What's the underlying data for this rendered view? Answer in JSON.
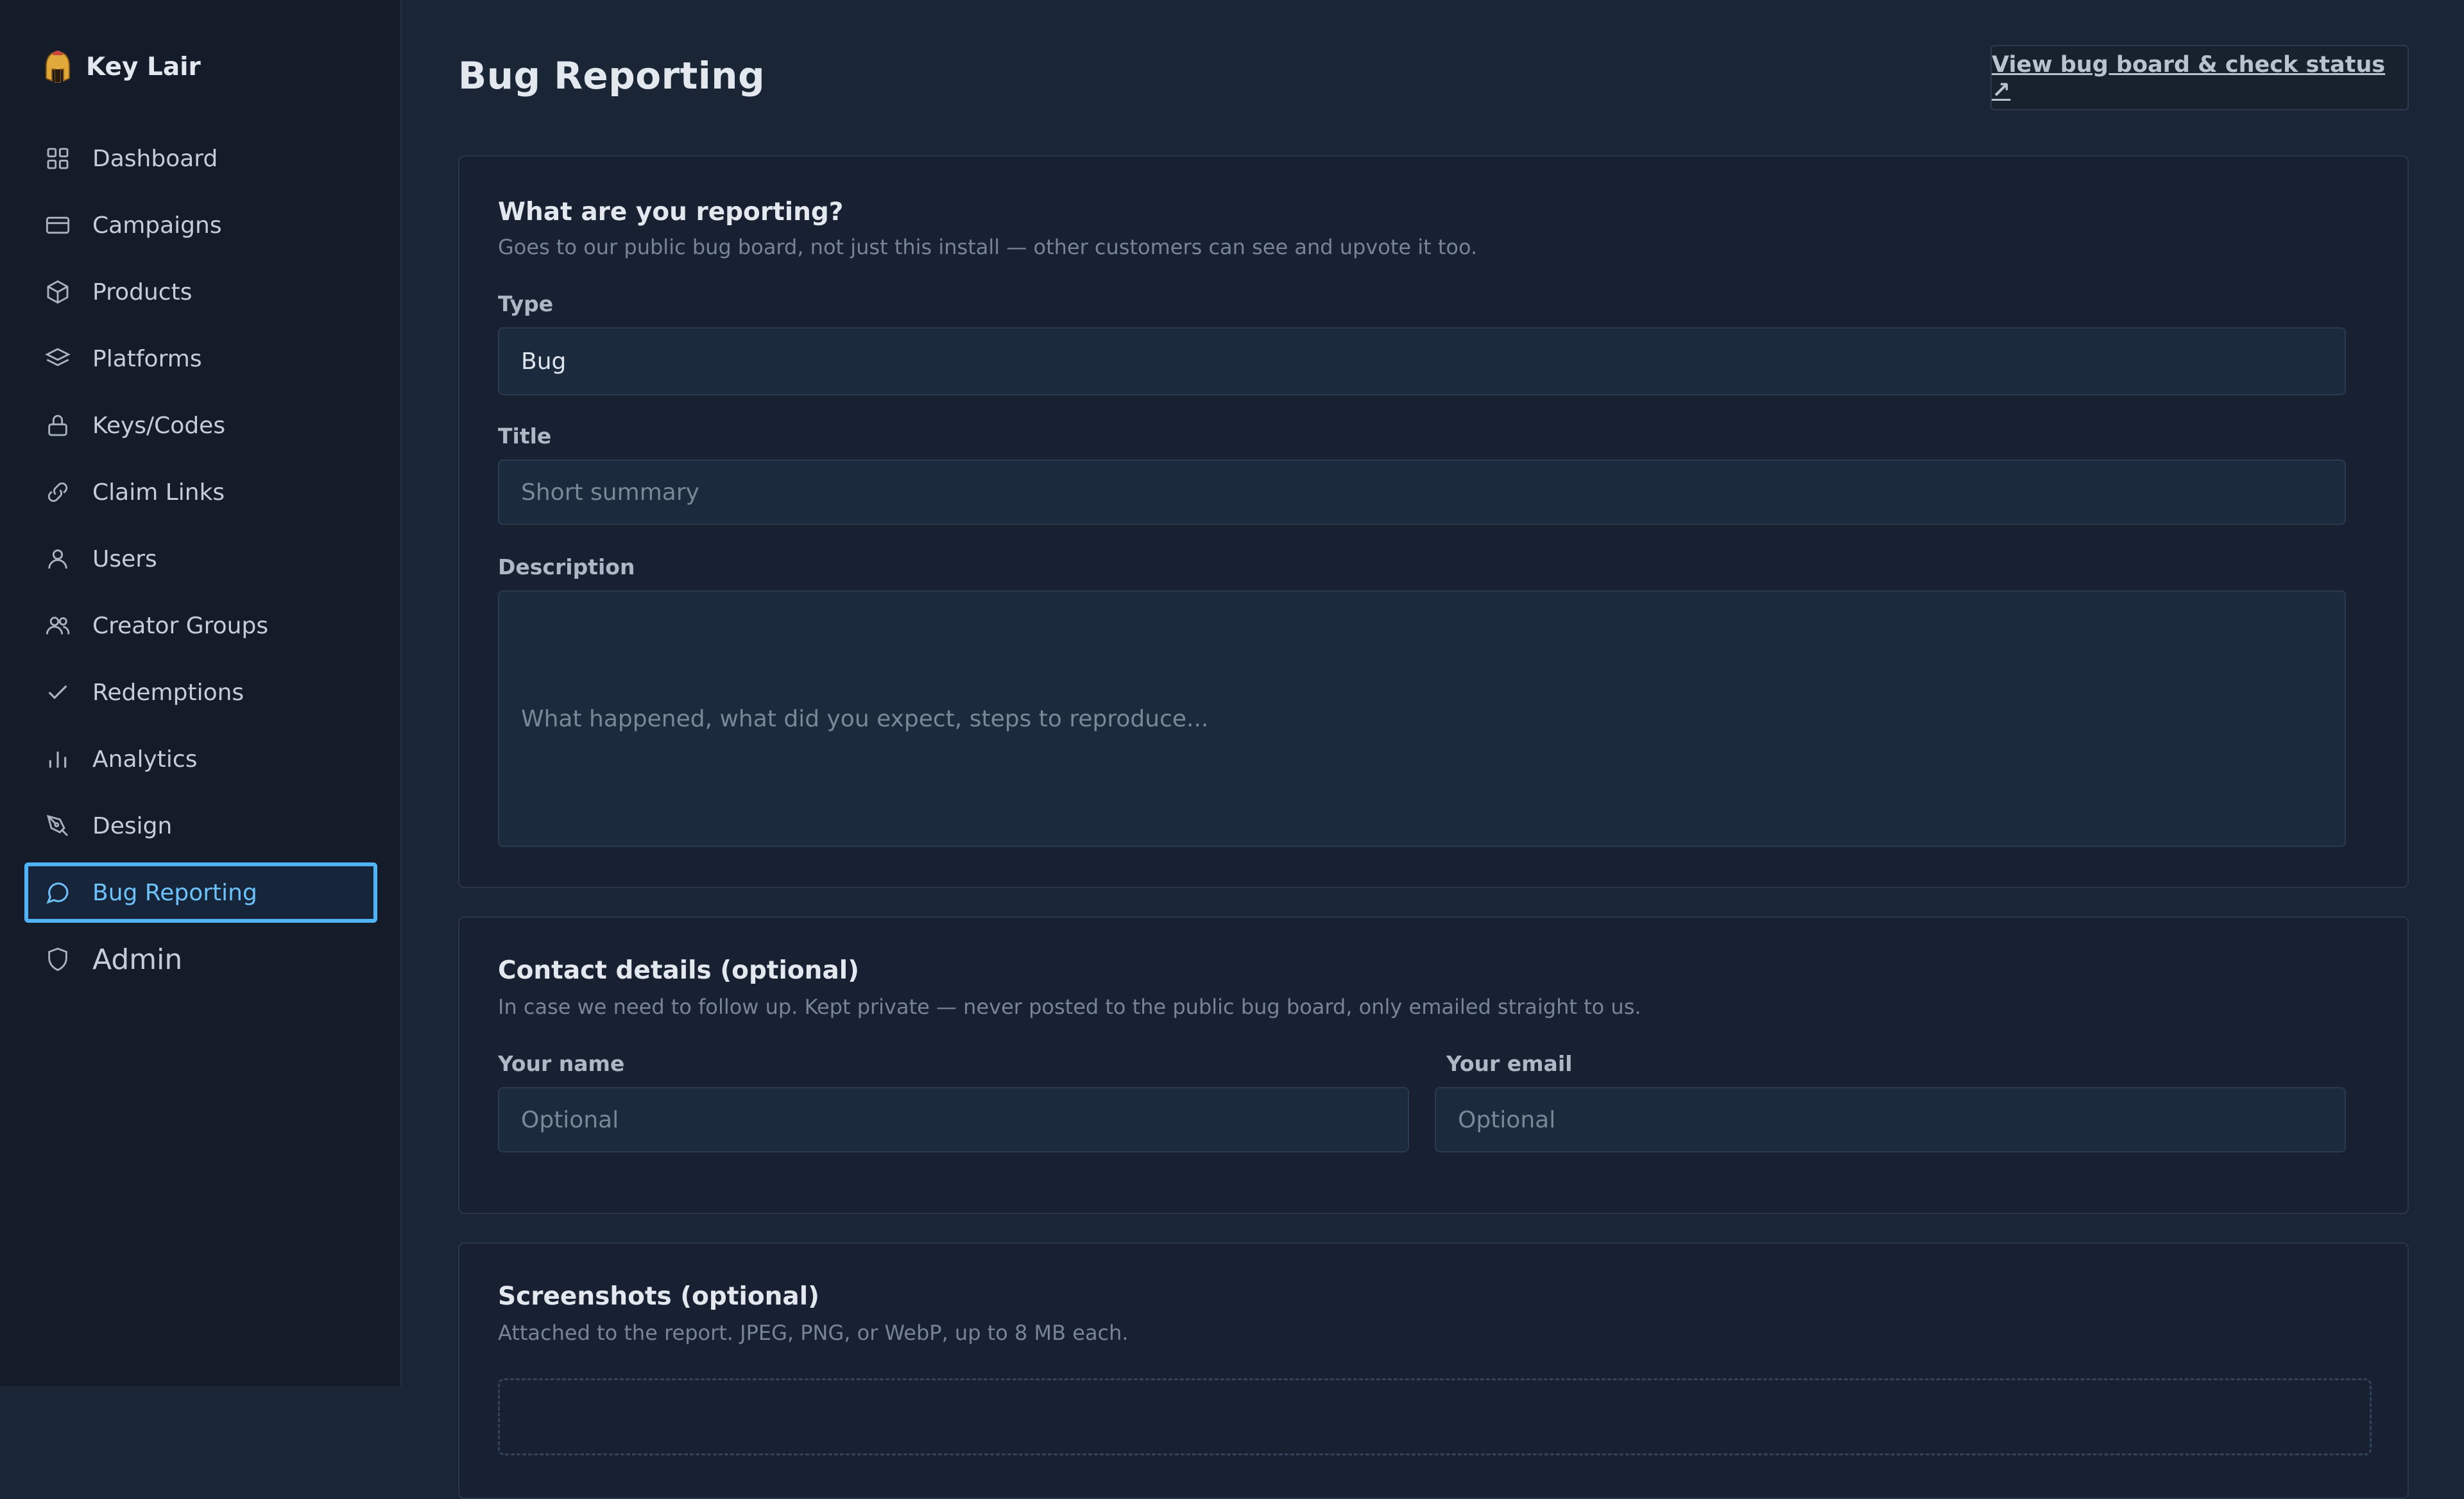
{
  "brand": {
    "name": "Key Lair",
    "icon": "spartan-helmet-icon"
  },
  "sidebar": {
    "items": [
      {
        "label": "Dashboard",
        "icon": "grid-icon"
      },
      {
        "label": "Campaigns",
        "icon": "card-icon"
      },
      {
        "label": "Products",
        "icon": "box-icon"
      },
      {
        "label": "Platforms",
        "icon": "layers-icon"
      },
      {
        "label": "Keys/Codes",
        "icon": "lock-icon"
      },
      {
        "label": "Claim Links",
        "icon": "link-icon"
      },
      {
        "label": "Users",
        "icon": "user-icon"
      },
      {
        "label": "Creator Groups",
        "icon": "users-icon"
      },
      {
        "label": "Redemptions",
        "icon": "check-icon"
      },
      {
        "label": "Analytics",
        "icon": "bar-chart-icon"
      },
      {
        "label": "Design",
        "icon": "pen-tool-icon"
      },
      {
        "label": "Bug Reporting",
        "icon": "message-circle-icon",
        "active": true
      },
      {
        "label": "Admin",
        "icon": "shield-icon"
      }
    ]
  },
  "header": {
    "title": "Bug Reporting",
    "board_link": "View bug board & check status ↗"
  },
  "report": {
    "title": "What are you reporting?",
    "subtitle": "Goes to our public bug board, not just this install — other customers can see and upvote it too.",
    "type_label": "Type",
    "type_value": "Bug",
    "title_label": "Title",
    "title_placeholder": "Short summary",
    "description_label": "Description",
    "description_placeholder": "What happened, what did you expect, steps to reproduce..."
  },
  "contact": {
    "title": "Contact details (optional)",
    "subtitle": "In case we need to follow up. Kept private — never posted to the public bug board, only emailed straight to us.",
    "name_label": "Your name",
    "name_placeholder": "Optional",
    "email_label": "Your email",
    "email_placeholder": "Optional"
  },
  "screenshots": {
    "title": "Screenshots (optional)",
    "subtitle": "Attached to the report. JPEG, PNG, or WebP, up to 8 MB each."
  },
  "colors": {
    "accent": "#4fb3f6",
    "background": "#1a2536",
    "sidebar": "#141c2a",
    "card": "#172131"
  }
}
